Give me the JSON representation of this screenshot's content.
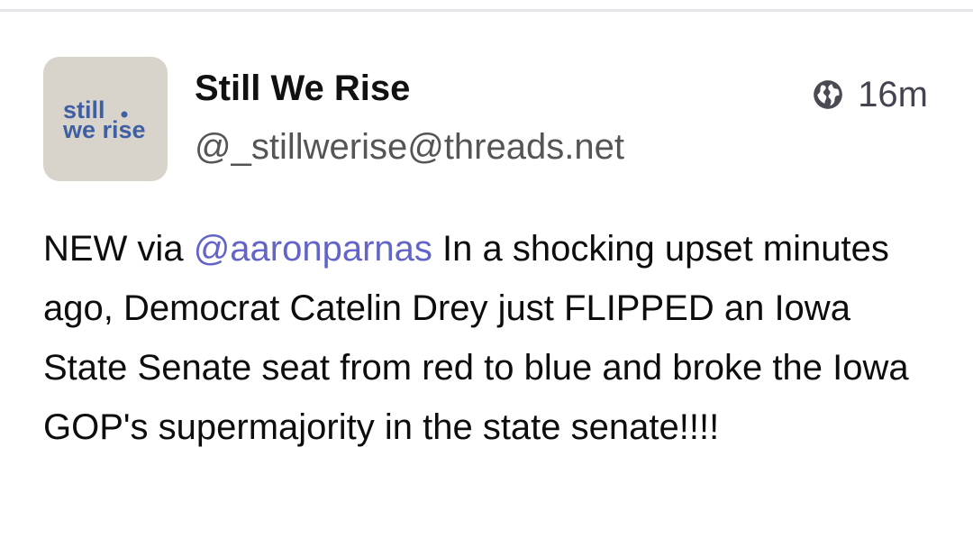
{
  "post": {
    "avatar": {
      "line1": "still",
      "line2": "we rise",
      "bg_color": "#d9d4cb",
      "text_color": "#3f5fa3"
    },
    "display_name": "Still We Rise",
    "handle": "@_stillwerise@threads.net",
    "visibility_icon": "globe-icon",
    "time": "16m",
    "content": {
      "lead": "NEW via ",
      "mention": "@aaronparnas",
      "body": " In a shocking upset minutes ago, Democrat Catelin Drey just FLIPPED an Iowa State Senate seat from red to blue and broke the Iowa GOP's supermajority in the state senate!!!!"
    },
    "colors": {
      "mention": "#6364c9",
      "text": "#0d0d0d",
      "secondary": "#555555"
    }
  }
}
